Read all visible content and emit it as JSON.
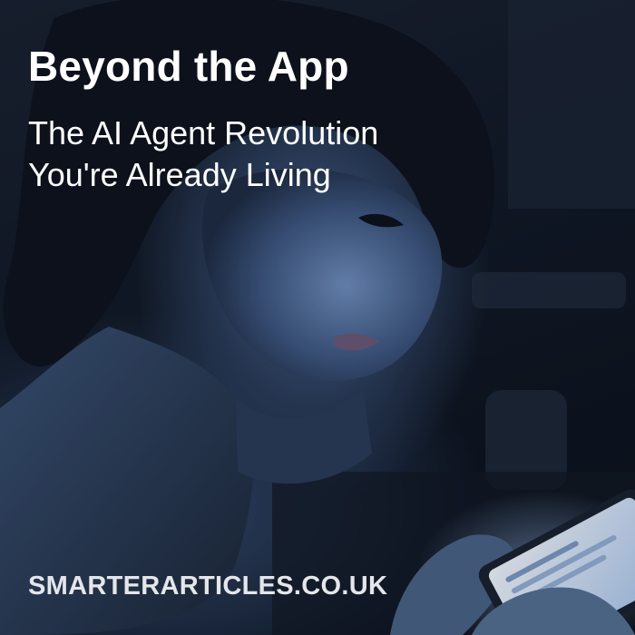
{
  "card": {
    "title": "Beyond the App",
    "subtitle_lines": [
      "The AI Agent Revolution",
      "You're Already Living"
    ],
    "site": "SMARTERARTICLES.CO.UK"
  },
  "colors": {
    "background": "#0b111c",
    "text": "#ffffff",
    "site_text": "#e4e6ea",
    "screen_glow": "#cfe3ff"
  }
}
